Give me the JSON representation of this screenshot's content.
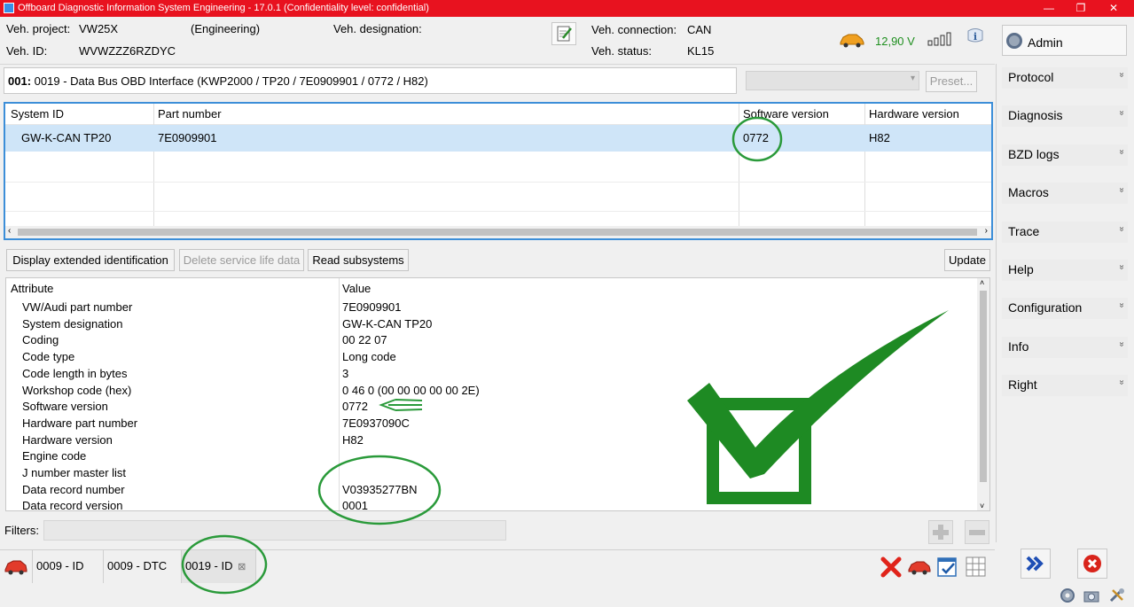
{
  "window": {
    "title": "Offboard Diagnostic Information System Engineering - 17.0.1 (Confidentiality level: confidential)",
    "controls": {
      "minimize": "—",
      "restore": "❐",
      "close": "✕"
    }
  },
  "header": {
    "veh_project_label": "Veh. project:",
    "veh_project_value": "VW25X",
    "mode": "(Engineering)",
    "veh_designation_label": "Veh. designation:",
    "veh_id_label": "Veh. ID:",
    "veh_id_value": "WVWZZZ6RZDYC",
    "veh_connection_label": "Veh. connection:",
    "veh_connection_value": "CAN",
    "veh_status_label": "Veh. status:",
    "veh_status_value": "KL15",
    "voltage": "12,90 V",
    "voltage_color": "#1f8f1f",
    "user": "Admin"
  },
  "ecu": {
    "address_bold": "001:",
    "description": "0019 - Data Bus OBD Interface  (KWP2000 / TP20 / 7E0909901 / 0772 / H82)",
    "preset_button": "Preset..."
  },
  "system_table": {
    "headers": [
      "System ID",
      "Part number",
      "Software version",
      "Hardware version"
    ],
    "rows": [
      {
        "system_id": "GW-K-CAN TP20",
        "part_number": "7E0909901",
        "software_version": "0772",
        "hardware_version": "H82"
      }
    ],
    "selection_color": "#cfe5f8"
  },
  "actions": {
    "display_extended": "Display extended identification",
    "delete_service": "Delete service life data",
    "read_subsystems": "Read subsystems",
    "update": "Update"
  },
  "attributes": {
    "header_attribute": "Attribute",
    "header_value": "Value",
    "rows": [
      {
        "k": "VW/Audi part number",
        "v": "7E0909901"
      },
      {
        "k": "System designation",
        "v": "GW-K-CAN TP20"
      },
      {
        "k": "Coding",
        "v": "00 22 07"
      },
      {
        "k": "Code type",
        "v": "Long code"
      },
      {
        "k": "Code length in bytes",
        "v": "3"
      },
      {
        "k": "Workshop code (hex)",
        "v": "0 46 0 (00 00 00 00 00 2E)"
      },
      {
        "k": "Software version",
        "v": "0772"
      },
      {
        "k": "Hardware part number",
        "v": "7E0937090C"
      },
      {
        "k": "Hardware version",
        "v": "H82"
      },
      {
        "k": "Engine code",
        "v": ""
      },
      {
        "k": "J number master list",
        "v": ""
      },
      {
        "k": "Data record number",
        "v": "V03935277BN"
      },
      {
        "k": "Data record version",
        "v": "0001"
      }
    ]
  },
  "filters": {
    "label": "Filters:",
    "value": ""
  },
  "tabs": [
    {
      "label": "0009 - ID"
    },
    {
      "label": "0009 - DTC"
    },
    {
      "label": "0019 - ID",
      "close": "⊠"
    }
  ],
  "sidebar": {
    "items": [
      {
        "label": "Protocol",
        "chevron": "»"
      },
      {
        "label": "Diagnosis",
        "chevron": "»"
      },
      {
        "label": "BZD logs",
        "chevron": "»"
      },
      {
        "label": "Macros",
        "chevron": "»"
      },
      {
        "label": "Trace",
        "chevron": "»"
      },
      {
        "label": "Help",
        "chevron": "»"
      },
      {
        "label": "Configuration",
        "chevron": "»"
      },
      {
        "label": "Info",
        "chevron": "»"
      },
      {
        "label": "Right",
        "chevron": "»"
      }
    ]
  },
  "colors": {
    "titlebar": "#e8121f",
    "annotation_green": "#2a9a3a",
    "check_green": "#1e8a23",
    "table_border": "#3c8ed8"
  },
  "icons": [
    "app-icon",
    "edit-icon",
    "car-icon",
    "signal-icon",
    "info-icon",
    "gear-icon",
    "car-tab-icon",
    "delete-x-icon",
    "car-action-icon",
    "checklist-icon",
    "grid-icon",
    "plus-icon",
    "minus-icon",
    "forward-icon",
    "close-red-icon",
    "settings-icon",
    "camera-icon",
    "tools-icon"
  ]
}
